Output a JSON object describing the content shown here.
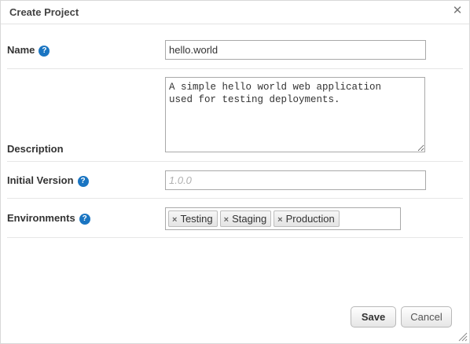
{
  "dialog": {
    "title": "Create Project",
    "close_icon": "close-icon"
  },
  "form": {
    "name": {
      "label": "Name",
      "value": "hello.world",
      "help_icon": "help-icon",
      "help_glyph": "?"
    },
    "description": {
      "label": "Description",
      "value": "A simple hello world web application\nused for testing deployments."
    },
    "initial_version": {
      "label": "Initial Version",
      "value": "",
      "placeholder": "1.0.0",
      "help_glyph": "?"
    },
    "environments": {
      "label": "Environments",
      "help_glyph": "?",
      "remove_glyph": "×",
      "tags": [
        "Testing",
        "Staging",
        "Production"
      ]
    }
  },
  "footer": {
    "save_label": "Save",
    "cancel_label": "Cancel"
  },
  "colors": {
    "help_icon": "#1a75c2",
    "border": "#a9a9a9",
    "divider": "#e6e6e6"
  }
}
